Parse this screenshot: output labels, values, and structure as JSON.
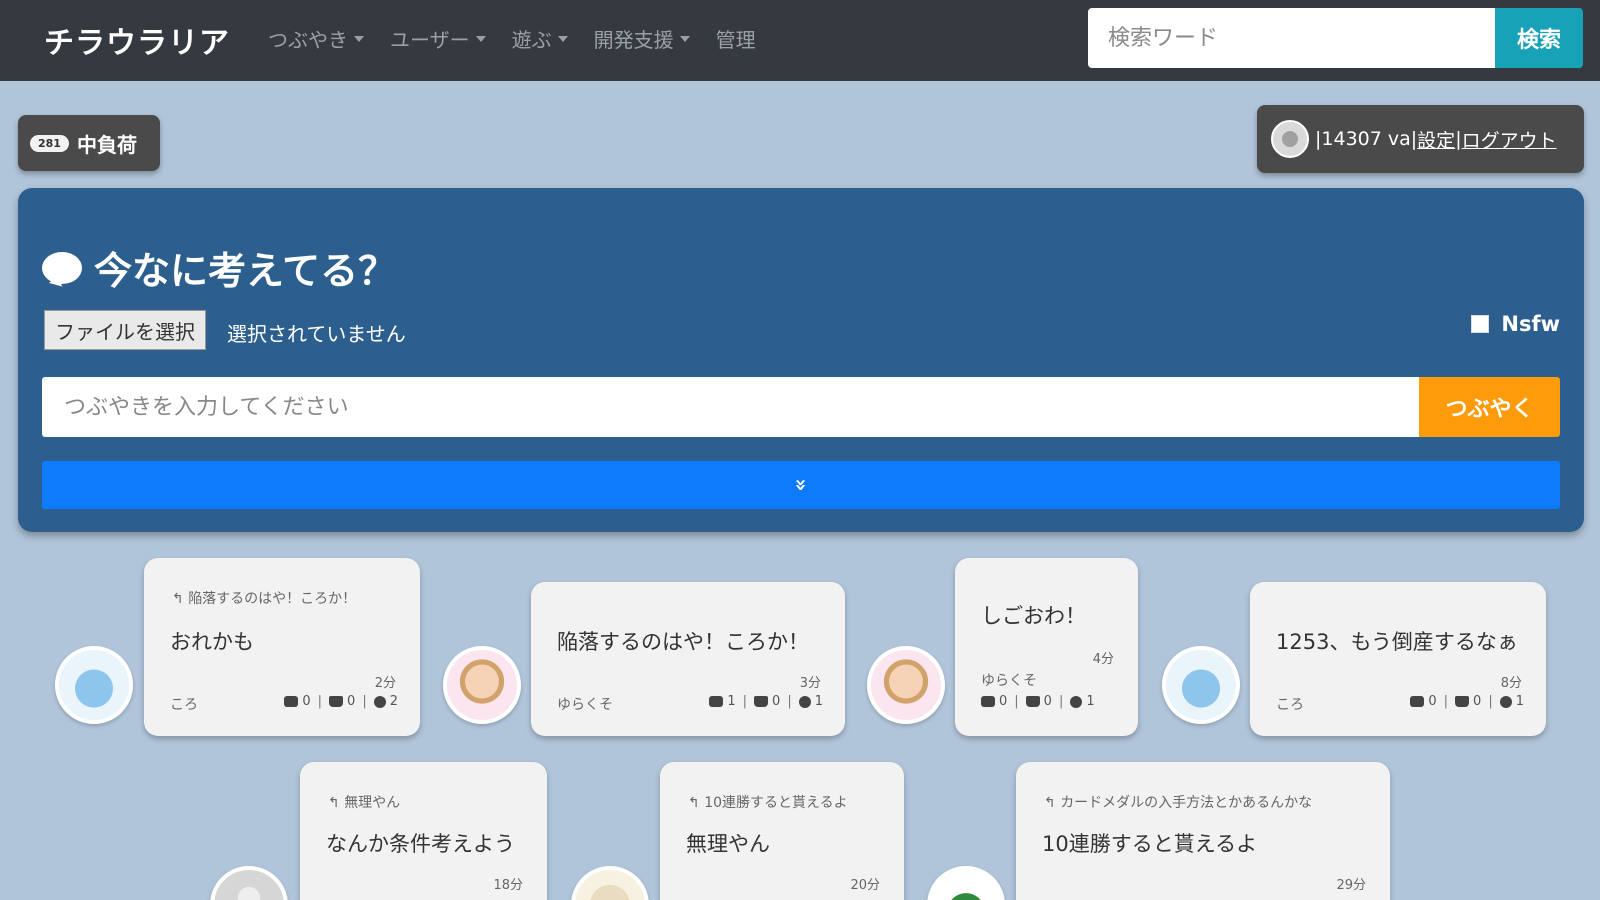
{
  "navbar": {
    "brand": "チラウラリア",
    "items": [
      {
        "label": "つぶやき",
        "dropdown": true
      },
      {
        "label": "ユーザー",
        "dropdown": true
      },
      {
        "label": "遊ぶ",
        "dropdown": true
      },
      {
        "label": "開発支援",
        "dropdown": true
      },
      {
        "label": "管理",
        "dropdown": false
      }
    ],
    "search_placeholder": "検索ワード",
    "search_button": "検索"
  },
  "load": {
    "count": "281",
    "label": "中負荷"
  },
  "user": {
    "id_text": "|14307 va|",
    "settings_link": "設定",
    "divider": "|",
    "logout_link": "ログアウト"
  },
  "post_panel": {
    "title": "今なに考えてる？",
    "file_button": "ファイルを選択",
    "file_status": "選択されていません",
    "nsfw_label": "Nsfw",
    "input_placeholder": "つぶやきを入力してください",
    "submit_label": "つぶやく",
    "expand_icon": "»"
  },
  "posts": [
    {
      "reply": "陥落するのはや！ころか！",
      "text": "おれかも",
      "time": "2分",
      "author": "ころ",
      "comments": "0",
      "likes": "0",
      "tags": "2"
    },
    {
      "reply": "",
      "text": "陥落するのはや！ころか！",
      "time": "3分",
      "author": "ゆらくそ",
      "comments": "1",
      "likes": "0",
      "tags": "1"
    },
    {
      "reply": "",
      "text": "しごおわ！",
      "time": "4分",
      "author": "ゆらくそ",
      "comments": "0",
      "likes": "0",
      "tags": "1"
    },
    {
      "reply": "",
      "text": "1253、もう倒産するなぁ",
      "time": "8分",
      "author": "ころ",
      "comments": "0",
      "likes": "0",
      "tags": "1"
    },
    {
      "reply": "無理やん",
      "text": "なんか条件考えよう",
      "time": "18分",
      "author": "",
      "comments": "",
      "likes": "",
      "tags": ""
    },
    {
      "reply": "10連勝すると貰えるよ",
      "text": "無理やん",
      "time": "20分",
      "author": "",
      "comments": "",
      "likes": "",
      "tags": ""
    },
    {
      "reply": "カードメダルの入手方法とかあるんかな",
      "text": "10連勝すると貰えるよ",
      "time": "29分",
      "author": "",
      "comments": "",
      "likes": "",
      "tags": ""
    }
  ],
  "colors": {
    "navbar": "#343a40",
    "page_bg": "#b1c5da",
    "panel": "#2c5f8d",
    "search_button": "#17a2b8",
    "post_button": "#fd9b0a",
    "expand_bar": "#0d7bfc"
  }
}
